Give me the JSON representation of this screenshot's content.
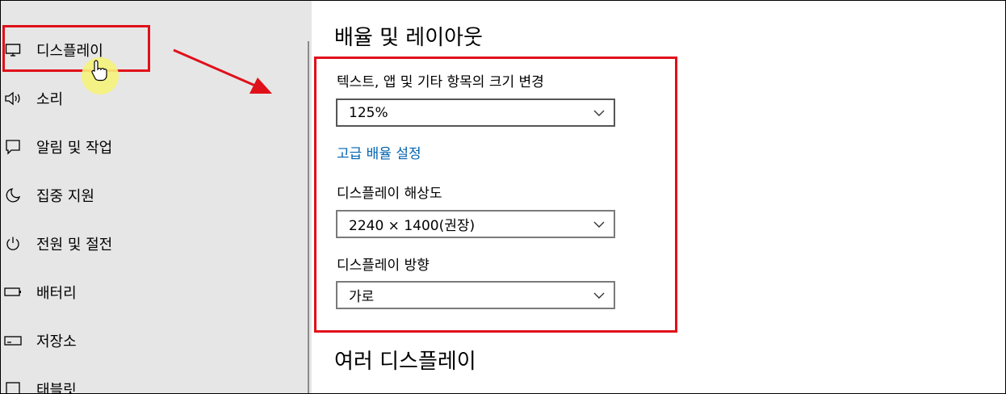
{
  "sidebar": {
    "items": [
      {
        "label": "디스플레이",
        "icon": "monitor-icon"
      },
      {
        "label": "소리",
        "icon": "speaker-icon"
      },
      {
        "label": "알림 및 작업",
        "icon": "notification-icon"
      },
      {
        "label": "집중 지원",
        "icon": "moon-icon"
      },
      {
        "label": "전원 및 절전",
        "icon": "power-icon"
      },
      {
        "label": "배터리",
        "icon": "battery-icon"
      },
      {
        "label": "저장소",
        "icon": "storage-icon"
      },
      {
        "label": "태블릿",
        "icon": "tablet-icon"
      }
    ]
  },
  "main": {
    "scale_section_title": "배율 및 레이아웃",
    "scale_label": "텍스트, 앱 및 기타 항목의 크기 변경",
    "scale_value": "125%",
    "advanced_scaling_link": "고급 배율 설정",
    "resolution_label": "디스플레이 해상도",
    "resolution_value": "2240 × 1400(권장)",
    "orientation_label": "디스플레이 방향",
    "orientation_value": "가로",
    "multi_display_title": "여러 디스플레이"
  },
  "colors": {
    "annotation_red": "#e0101a",
    "link_blue": "#0063b1",
    "sidebar_bg": "#e6e6e6",
    "cursor_highlight": "#f5f27a"
  }
}
